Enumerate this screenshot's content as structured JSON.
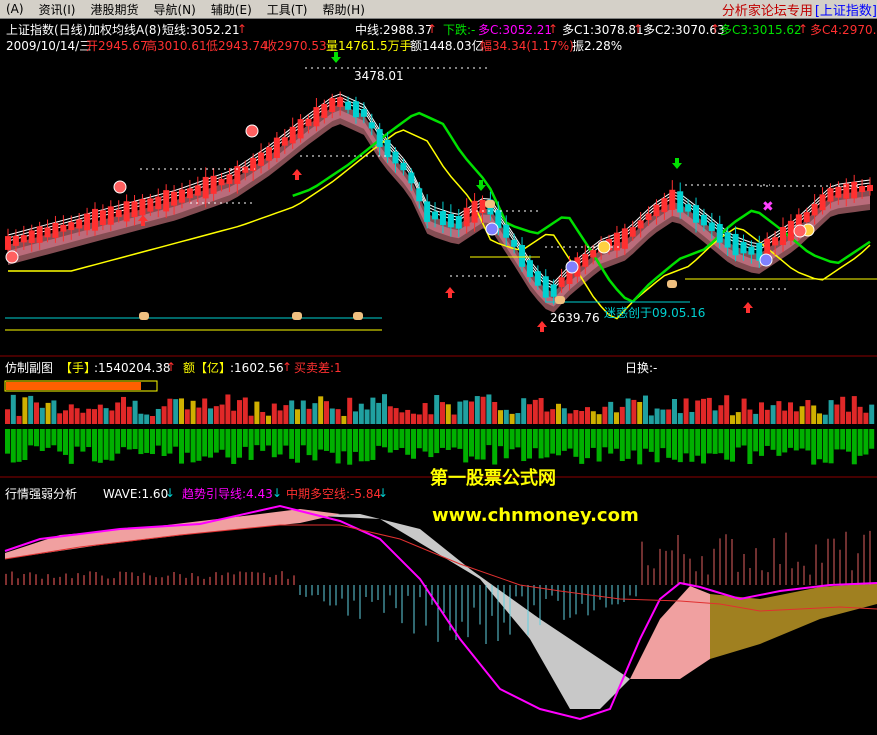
{
  "menu": {
    "items": [
      "(A)",
      "资讯(I)",
      "港股期货",
      "导航(N)",
      "辅助(E)",
      "工具(T)",
      "帮助(H)"
    ],
    "title_red": "分析家论坛专用",
    "title_blue": "[上证指数]"
  },
  "main_panel": {
    "title": "上证指数(日线)",
    "indicator": "加权均线A(8)",
    "short_line": "短线:3052.21",
    "mid_line": "中线:2988.37",
    "down_label": "下跌:-",
    "c_duo": "多C:3052.21",
    "c1": "多C1:3078.81",
    "c2": "多C2:3070.63",
    "c3": "多C3:3015.62",
    "c4": "多C4:2970.4",
    "date": "2009/10/14/三",
    "open": "开2945.67",
    "high": "高3010.61",
    "low": "低2943.74",
    "close": "收2970.53",
    "volume": "量14761.5万手",
    "amount": "额1448.03亿",
    "range": "幅34.34(1.17%)",
    "amplitude": "振2.28%",
    "high_mark": "3478.01",
    "low_mark": "2639.76",
    "note": "迷惑创于09.05.16"
  },
  "sub_panel": {
    "title": "仿制副图",
    "hands_label": "【手】",
    "hands_value": ":1540204.38",
    "amount_label": "额【亿】",
    "amount_value": ":1602.56",
    "buy_sell": "买卖差:1",
    "turnover": "日换:-"
  },
  "strength_panel": {
    "title": "行情强弱分析",
    "wave": "WAVE:1.60",
    "trend": "趋势引导线:4.43",
    "mid_term": "中期多空线:-5.84"
  },
  "watermark": {
    "line1": "第一股票公式网",
    "line2": "www.chnmoney.com"
  },
  "colors": {
    "up": "#ff3030",
    "down": "#00d0d0",
    "ma_yellow": "#ffff00",
    "ma_green": "#00e000",
    "magenta": "#ff00ff",
    "pink_fill": "#f0a0a0",
    "gray_fill": "#c8c8c8",
    "olive_fill": "#a08020",
    "panel_border": "#8b0000"
  }
}
